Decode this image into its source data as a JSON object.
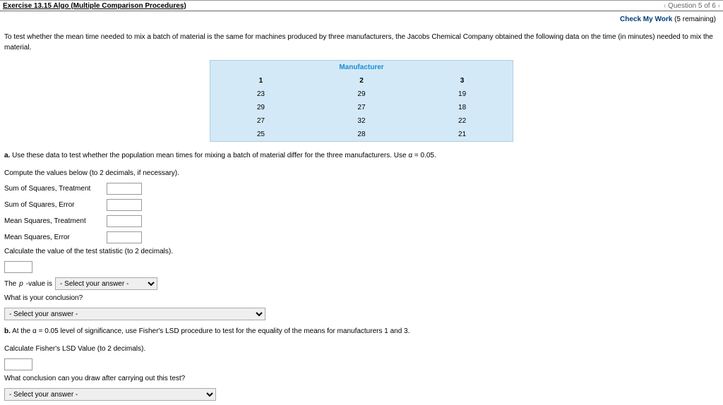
{
  "header": {
    "exercise_title": "Exercise 13.15 Algo (Multiple Comparison Procedures)",
    "question_nav": "Question 5 of 6",
    "check_work_label": "Check My Work",
    "remaining_text": "(5 remaining)"
  },
  "intro": "To test whether the mean time needed to mix a batch of material is the same for machines produced by three manufacturers, the Jacobs Chemical Company obtained the following data on the time (in minutes) needed to mix the material.",
  "table": {
    "header_label": "Manufacturer",
    "cols": [
      "1",
      "2",
      "3"
    ],
    "rows": [
      [
        "23",
        "29",
        "19"
      ],
      [
        "29",
        "27",
        "18"
      ],
      [
        "27",
        "32",
        "22"
      ],
      [
        "25",
        "28",
        "21"
      ]
    ]
  },
  "partA": {
    "prefix": "a.",
    "text": " Use these data to test whether the population mean times for mixing a batch of material differ for the three manufacturers. Use α = 0.05.",
    "compute_instruction": "Compute the values below (to 2 decimals, if necessary).",
    "fields": [
      "Sum of Squares, Treatment",
      "Sum of Squares, Error",
      "Mean Squares, Treatment",
      "Mean Squares, Error"
    ],
    "calc_stat_text": "Calculate the value of the test statistic (to 2 decimals).",
    "pvalue_prefix": "The ",
    "pvalue_p": "p",
    "pvalue_suffix": "-value is",
    "conclusion_prompt": "What is your conclusion?",
    "select_placeholder": "- Select your answer -"
  },
  "partB": {
    "prefix": "b.",
    "text": " At the α = 0.05 level of significance, use Fisher's LSD procedure to test for the equality of the means for manufacturers 1 and 3.",
    "calc_lsd_text": "Calculate Fisher's LSD Value (to 2 decimals).",
    "conclusion_prompt": "What conclusion can you draw after carrying out this test?",
    "select_placeholder": "- Select your answer -"
  }
}
